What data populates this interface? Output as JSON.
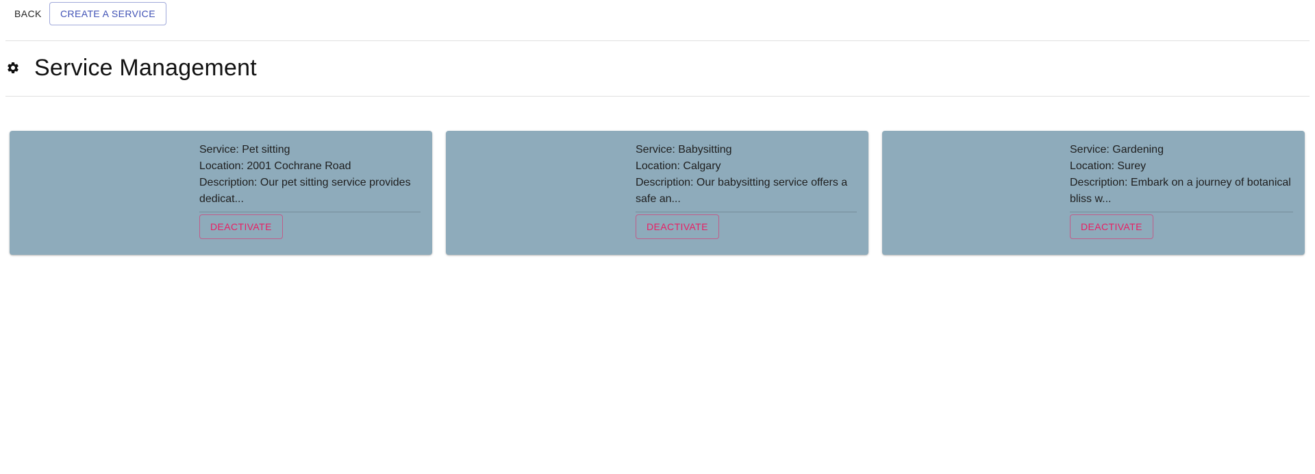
{
  "toolbar": {
    "back_label": "BACK",
    "create_label": "CREATE A SERVICE"
  },
  "header": {
    "icon": "gear-icon",
    "title": "Service Management"
  },
  "colors": {
    "card_background": "#8eabbb",
    "primary": "#3f51b5",
    "danger": "#e91e63"
  },
  "services": [
    {
      "service": "Service: Pet sitting",
      "location": "Location: 2001 Cochrane Road",
      "description": "Description: Our pet sitting service provides dedicat...",
      "action_label": "DEACTIVATE"
    },
    {
      "service": "Service: Babysitting",
      "location": "Location: Calgary",
      "description": "Description: Our babysitting service offers a safe an...",
      "action_label": "DEACTIVATE"
    },
    {
      "service": "Service: Gardening",
      "location": "Location: Surey",
      "description": "Description: Embark on a journey of botanical bliss w...",
      "action_label": "DEACTIVATE"
    }
  ]
}
